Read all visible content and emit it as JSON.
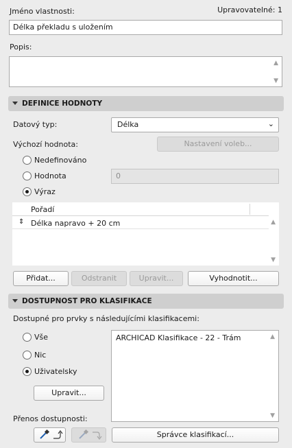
{
  "header": {
    "property_name_label": "Jméno vlastnosti:",
    "editable_label": "Upravovatelné: 1",
    "property_name_value": "Délka překladu s uložením",
    "description_label": "Popis:",
    "description_value": ""
  },
  "value_definition": {
    "section_title": "DEFINICE HODNOTY",
    "data_type_label": "Datový typ:",
    "data_type_value": "Délka",
    "default_value_label": "Výchozí hodnota:",
    "option_settings_button": "Nastavení voleb...",
    "radio_undefined": "Nedefinováno",
    "radio_value": "Hodnota",
    "value_input": "0",
    "radio_expression": "Výraz",
    "selected_radio": "expression",
    "expression_table": {
      "column_header": "Pořadí",
      "rows": [
        {
          "handle": "⇕",
          "text": "Délka napravo + 20 cm"
        }
      ]
    },
    "buttons": {
      "add": "Přidat...",
      "remove": "Odstranit",
      "edit": "Upravit...",
      "evaluate": "Vyhodnotit..."
    }
  },
  "classification": {
    "section_title": "DOSTUPNOST PRO KLASIFIKACE",
    "available_label": "Dostupné pro prvky s následujícími klasifikacemi:",
    "radio_all": "Vše",
    "radio_none": "Nic",
    "radio_custom": "Uživatelsky",
    "selected_radio": "custom",
    "edit_button": "Upravit...",
    "list_items": [
      "ARCHICAD Klasifikace - 22 - Trám"
    ],
    "transfer_label": "Přenos dostupnosti:",
    "manager_button": "Správce klasifikací..."
  }
}
